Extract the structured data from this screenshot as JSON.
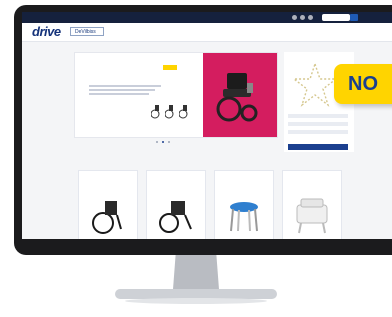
{
  "page": {
    "heading_fragment": "",
    "promo_badge": "NO"
  },
  "site": {
    "logo_primary": "drive",
    "logo_secondary": "DeVilbiss",
    "nav_items": [
      "",
      "",
      "",
      "",
      "",
      ""
    ]
  },
  "hero": {
    "kicker": "",
    "title": "",
    "subtitle": ""
  },
  "side_panel": {
    "title": "",
    "button_label": ""
  },
  "products": {
    "section_title": "",
    "items": [
      {
        "name": "",
        "ref": ""
      },
      {
        "name": "",
        "ref": ""
      },
      {
        "name": "",
        "ref": ""
      },
      {
        "name": "",
        "ref": ""
      }
    ],
    "view_more": ""
  },
  "colors": {
    "brand_blue": "#1b3f8f",
    "accent_pink": "#d41d5f",
    "promo_yellow": "#ffd400",
    "topbar": "#15213d"
  }
}
